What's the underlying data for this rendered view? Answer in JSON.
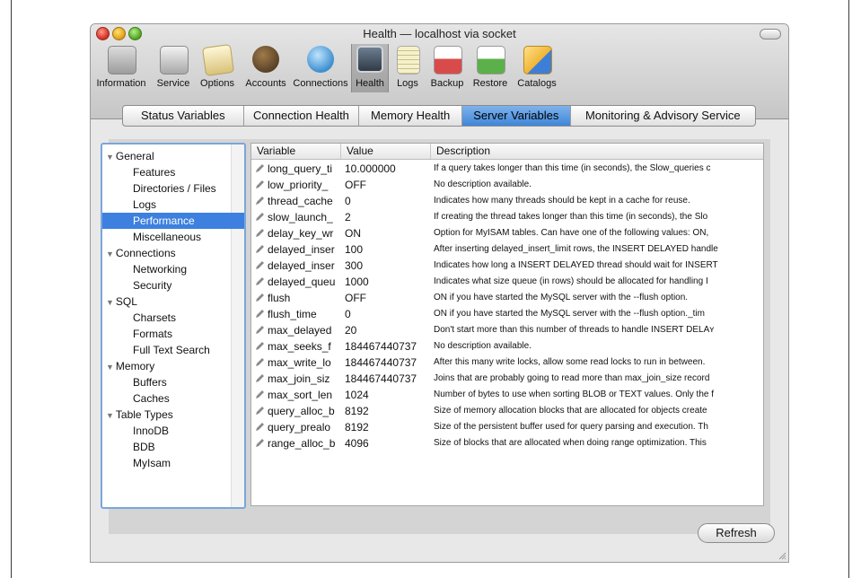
{
  "window": {
    "title": "Health — localhost via socket"
  },
  "toolbar": {
    "items": [
      {
        "label": "Information",
        "icon": "information-icon",
        "color": "#9c9c9c"
      },
      {
        "label": "Service",
        "icon": "service-icon",
        "color": "#a8a8a8"
      },
      {
        "label": "Options",
        "icon": "options-icon",
        "color": "#d9c27a"
      },
      {
        "label": "Accounts",
        "icon": "accounts-icon",
        "color": "#6b4a2a"
      },
      {
        "label": "Connections",
        "icon": "connections-icon",
        "color": "#3d8fcf"
      },
      {
        "label": "Health",
        "icon": "health-icon",
        "color": "#4a5a6a"
      },
      {
        "label": "Logs",
        "icon": "logs-icon",
        "color": "#e9e3b5"
      },
      {
        "label": "Backup",
        "icon": "backup-icon",
        "color": "#d94b4b"
      },
      {
        "label": "Restore",
        "icon": "restore-icon",
        "color": "#5cb04a"
      },
      {
        "label": "Catalogs",
        "icon": "catalogs-icon",
        "color": "#f0b535"
      }
    ],
    "selected": "Health"
  },
  "tabs": [
    {
      "label": "Status Variables",
      "active": false
    },
    {
      "label": "Connection Health",
      "active": false
    },
    {
      "label": "Memory Health",
      "active": false
    },
    {
      "label": "Server Variables",
      "active": true
    },
    {
      "label": "Monitoring & Advisory Service",
      "active": false
    }
  ],
  "sidebar": {
    "items": [
      {
        "label": "General",
        "group": true
      },
      {
        "label": "Features",
        "group": false
      },
      {
        "label": "Directories / Files",
        "group": false
      },
      {
        "label": "Logs",
        "group": false
      },
      {
        "label": "Performance",
        "group": false,
        "selected": true
      },
      {
        "label": "Miscellaneous",
        "group": false
      },
      {
        "label": "Connections",
        "group": true
      },
      {
        "label": "Networking",
        "group": false
      },
      {
        "label": "Security",
        "group": false
      },
      {
        "label": "SQL",
        "group": true
      },
      {
        "label": "Charsets",
        "group": false
      },
      {
        "label": "Formats",
        "group": false
      },
      {
        "label": "Full Text Search",
        "group": false
      },
      {
        "label": "Memory",
        "group": true
      },
      {
        "label": "Buffers",
        "group": false
      },
      {
        "label": "Caches",
        "group": false
      },
      {
        "label": "Table Types",
        "group": true
      },
      {
        "label": "InnoDB",
        "group": false
      },
      {
        "label": "BDB",
        "group": false
      },
      {
        "label": "MyIsam",
        "group": false
      }
    ]
  },
  "table": {
    "headers": {
      "variable": "Variable",
      "value": "Value",
      "description": "Description"
    },
    "rows": [
      {
        "variable": "long_query_ti",
        "value": "10.000000",
        "description": "If a query takes longer than this time (in seconds), the Slow_queries c"
      },
      {
        "variable": "low_priority_",
        "value": "OFF",
        "description": "No description available."
      },
      {
        "variable": "thread_cache",
        "value": "0",
        "description": "Indicates how many threads should be kept in a cache for reuse."
      },
      {
        "variable": "slow_launch_",
        "value": "2",
        "description": "If creating the thread takes longer than this time (in seconds), the Slo"
      },
      {
        "variable": "delay_key_wr",
        "value": "ON",
        "description": "Option for MyISAM tables. Can have one of the following values: ON,"
      },
      {
        "variable": "delayed_inser",
        "value": "100",
        "description": "After inserting delayed_insert_limit rows, the INSERT DELAYED handle"
      },
      {
        "variable": "delayed_inser",
        "value": "300",
        "description": "Indicates how long a INSERT DELAYED thread should wait for INSERT"
      },
      {
        "variable": "delayed_queu",
        "value": "1000",
        "description": "Indicates what size queue (in rows) should be allocated for handling I"
      },
      {
        "variable": "flush",
        "value": "OFF",
        "description": "ON if you have started the MySQL server with the --flush option."
      },
      {
        "variable": "flush_time",
        "value": "0",
        "description": "ON if you have started the MySQL server with the --flush option._tim"
      },
      {
        "variable": "max_delayed",
        "value": "20",
        "description": "Don't start more than this number of threads to handle INSERT DELAʏ"
      },
      {
        "variable": "max_seeks_f",
        "value": "184467440737",
        "description": "No description available."
      },
      {
        "variable": "max_write_lo",
        "value": "184467440737",
        "description": "After this many write locks, allow some read locks to run in between."
      },
      {
        "variable": "max_join_siz",
        "value": "184467440737",
        "description": "Joins that are probably going to read more than max_join_size record"
      },
      {
        "variable": "max_sort_len",
        "value": "1024",
        "description": "Number of bytes to use when sorting BLOB or TEXT values. Only the f"
      },
      {
        "variable": "query_alloc_b",
        "value": "8192",
        "description": "Size of memory allocation blocks that are allocated for objects create"
      },
      {
        "variable": "query_prealo",
        "value": "8192",
        "description": "Size of the persistent buffer used for query parsing and execution. Th"
      },
      {
        "variable": "range_alloc_b",
        "value": "4096",
        "description": "Size of blocks that are allocated when doing range optimization. This"
      }
    ]
  },
  "buttons": {
    "refresh": "Refresh"
  }
}
